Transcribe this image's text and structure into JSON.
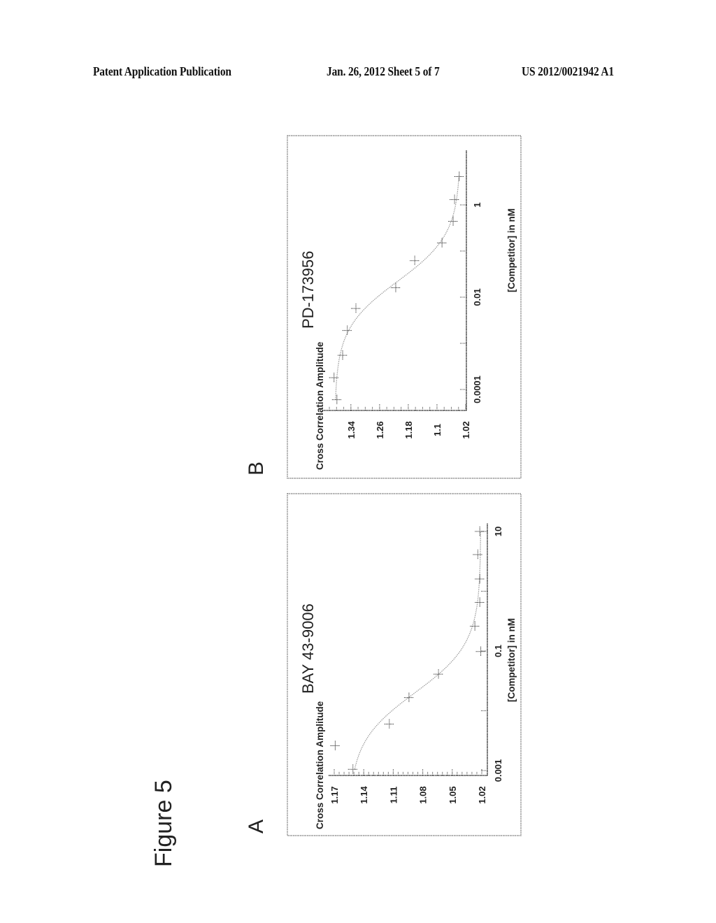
{
  "header": {
    "left": "Patent Application Publication",
    "middle": "Jan. 26, 2012   Sheet 5 of 7",
    "right": "US 2012/0021942 A1"
  },
  "figure_label": "Figure 5",
  "chart_data": [
    {
      "panel": "A",
      "type": "scatter",
      "title": "BAY 43-9006",
      "xlabel": "[Competitor] in nM",
      "ylabel": "Cross Correlation Amplitude",
      "x_scale": "log",
      "xlim": [
        0.001,
        10
      ],
      "ylim": [
        1.02,
        1.17
      ],
      "x_ticks": [
        0.001,
        0.01,
        0.1,
        1,
        10
      ],
      "x_tick_labels": [
        "0.001",
        "",
        "0.1",
        "",
        "10"
      ],
      "y_ticks": [
        1.17,
        1.14,
        1.11,
        1.08,
        1.05,
        1.02
      ],
      "y_tick_labels": [
        "1.17",
        "1.14",
        "1.11",
        "1.08",
        "1.05",
        "1.02"
      ],
      "points": [
        {
          "x": 0.00105,
          "y": 1.151
        },
        {
          "x": 0.0026,
          "y": 1.169
        },
        {
          "x": 0.006,
          "y": 1.114
        },
        {
          "x": 0.0166,
          "y": 1.094
        },
        {
          "x": 0.041,
          "y": 1.064
        },
        {
          "x": 0.098,
          "y": 1.021
        },
        {
          "x": 0.26,
          "y": 1.027
        },
        {
          "x": 0.65,
          "y": 1.022
        },
        {
          "x": 1.6,
          "y": 1.022
        },
        {
          "x": 4.1,
          "y": 1.024
        },
        {
          "x": 10,
          "y": 1.022
        }
      ],
      "fit_curve": true,
      "grid": false
    },
    {
      "panel": "B",
      "type": "scatter",
      "title": "PD-173956",
      "xlabel": "[Competitor] in nM",
      "ylabel": "Cross Correlation Amplitude",
      "x_scale": "log",
      "xlim": [
        0.0001,
        10
      ],
      "ylim": [
        1.02,
        1.4
      ],
      "x_ticks": [
        0.0001,
        0.001,
        0.01,
        0.1,
        1
      ],
      "x_tick_labels": [
        "0.0001",
        "",
        "0.01",
        "",
        "1"
      ],
      "y_ticks": [
        1.34,
        1.26,
        1.18,
        1.1,
        1.02
      ],
      "y_tick_labels": [
        "1.34",
        "1.26",
        "1.18",
        "1.1",
        "1.02"
      ],
      "points": [
        {
          "x": 6e-05,
          "y": 1.379
        },
        {
          "x": 0.00018,
          "y": 1.387
        },
        {
          "x": 0.00055,
          "y": 1.363
        },
        {
          "x": 0.0019,
          "y": 1.35
        },
        {
          "x": 0.0057,
          "y": 1.326
        },
        {
          "x": 0.016,
          "y": 1.215
        },
        {
          "x": 0.062,
          "y": 1.162
        },
        {
          "x": 0.15,
          "y": 1.086
        },
        {
          "x": 0.44,
          "y": 1.055
        },
        {
          "x": 1.3,
          "y": 1.051
        },
        {
          "x": 4.1,
          "y": 1.038
        }
      ],
      "fit_curve": true,
      "grid": false
    }
  ]
}
